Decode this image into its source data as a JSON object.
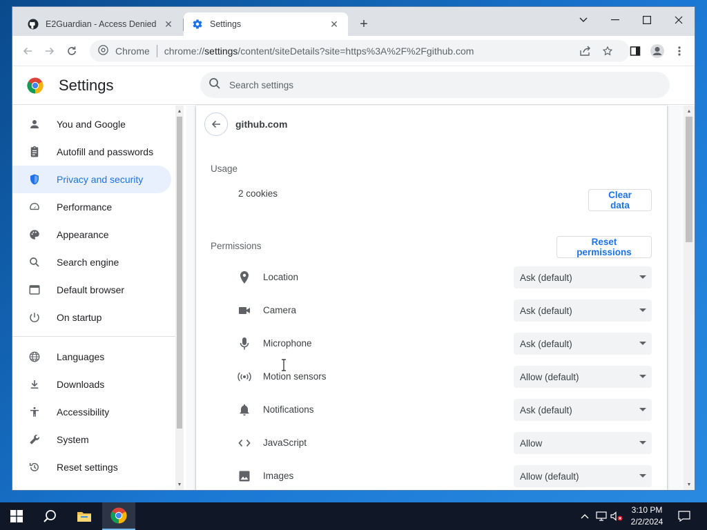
{
  "browser": {
    "tabs": [
      {
        "title": "E2Guardian - Access Denied",
        "active": false
      },
      {
        "title": "Settings",
        "active": true
      }
    ],
    "new_tab_label": "+",
    "omnibox": {
      "site_label": "Chrome",
      "url_prefix": "chrome://",
      "url_host": "settings",
      "url_rest": "/content/siteDetails?site=https%3A%2F%2Fgithub.com"
    }
  },
  "settings": {
    "title": "Settings",
    "search_placeholder": "Search settings"
  },
  "nav": {
    "items": [
      {
        "label": "You and Google",
        "icon": "person-icon",
        "active": false
      },
      {
        "label": "Autofill and passwords",
        "icon": "clipboard-icon",
        "active": false
      },
      {
        "label": "Privacy and security",
        "icon": "shield-icon",
        "active": true
      },
      {
        "label": "Performance",
        "icon": "speedometer-icon",
        "active": false
      },
      {
        "label": "Appearance",
        "icon": "palette-icon",
        "active": false
      },
      {
        "label": "Search engine",
        "icon": "search-icon",
        "active": false
      },
      {
        "label": "Default browser",
        "icon": "browser-icon",
        "active": false
      },
      {
        "label": "On startup",
        "icon": "power-icon",
        "active": false
      },
      {
        "label": "Languages",
        "icon": "globe-icon",
        "active": false
      },
      {
        "label": "Downloads",
        "icon": "download-icon",
        "active": false
      },
      {
        "label": "Accessibility",
        "icon": "accessibility-icon",
        "active": false
      },
      {
        "label": "System",
        "icon": "wrench-icon",
        "active": false
      },
      {
        "label": "Reset settings",
        "icon": "history-icon",
        "active": false
      }
    ]
  },
  "site_details": {
    "site": "github.com",
    "usage_label": "Usage",
    "cookies_text": "2 cookies",
    "clear_data_label": "Clear data",
    "permissions_label": "Permissions",
    "reset_permissions_label": "Reset permissions",
    "permissions": [
      {
        "label": "Location",
        "value": "Ask (default)",
        "icon": "location-pin-icon"
      },
      {
        "label": "Camera",
        "value": "Ask (default)",
        "icon": "camera-icon"
      },
      {
        "label": "Microphone",
        "value": "Ask (default)",
        "icon": "microphone-icon"
      },
      {
        "label": "Motion sensors",
        "value": "Allow (default)",
        "icon": "motion-sensor-icon"
      },
      {
        "label": "Notifications",
        "value": "Ask (default)",
        "icon": "bell-icon"
      },
      {
        "label": "JavaScript",
        "value": "Allow",
        "icon": "code-icon"
      },
      {
        "label": "Images",
        "value": "Allow (default)",
        "icon": "image-icon"
      }
    ]
  },
  "taskbar": {
    "time": "3:10 PM",
    "date": "2/2/2024"
  }
}
